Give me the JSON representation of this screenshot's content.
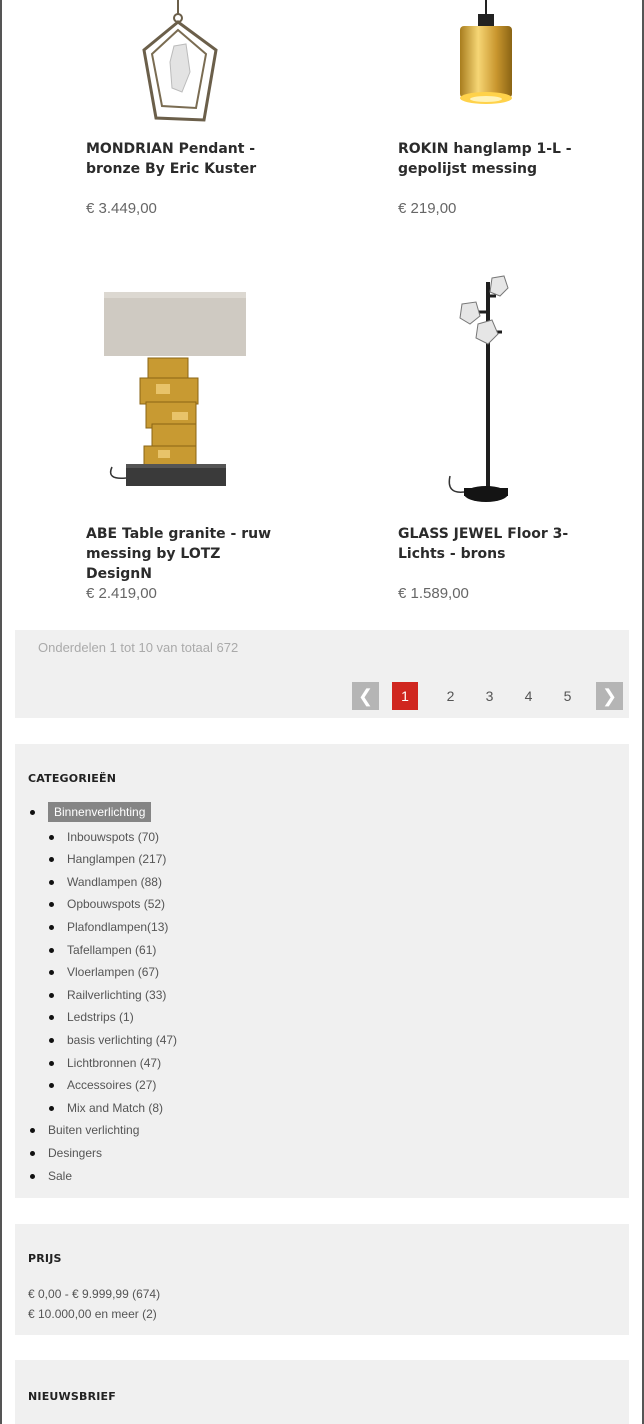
{
  "products": [
    {
      "name_line1": "MONDRIAN Pendant -",
      "name_line2": "bronze By Eric Kuster",
      "price": "€ 3.449,00",
      "icon": "pendant-lamp-image"
    },
    {
      "name_line1": "ROKIN hanglamp 1-L -",
      "name_line2": "gepolijst messing",
      "price": "€ 219,00",
      "icon": "brass-pendant-image"
    },
    {
      "name_line1": "ABE Table granite - ruw",
      "name_line2": "messing by LOTZ DesignN",
      "price": "€ 2.419,00",
      "icon": "table-lamp-image"
    },
    {
      "name_line1": "GLASS JEWEL Floor 3-",
      "name_line2": "Lichts - brons",
      "price": "€ 1.589,00",
      "icon": "floor-lamp-image"
    }
  ],
  "pager": {
    "count_text": "Onderdelen 1 tot 10 van totaal 672",
    "prev_icon": "chevron-left-icon",
    "next_icon": "chevron-right-icon",
    "pages": [
      "1",
      "2",
      "3",
      "4",
      "5"
    ],
    "active_page": "1",
    "active_color": "#d0261f"
  },
  "categories": {
    "title": "CATEGORIEËN",
    "active": "Binnenverlichting",
    "sub": [
      "Inbouwspots (70)",
      "Hanglampen (217)",
      "Wandlampen (88)",
      "Opbouwspots (52)",
      "Plafondlampen(13)",
      "Tafellampen (61)",
      "Vloerlampen (67)",
      "Railverlichting (33)",
      "Ledstrips (1)",
      "basis verlichting (47)",
      "Lichtbronnen (47)",
      "Accessoires (27)",
      "Mix and Match (8)"
    ],
    "others": [
      "Buiten verlichting",
      "Desingers",
      "Sale"
    ]
  },
  "price_filter": {
    "title": "PRIJS",
    "ranges": [
      "€ 0,00 - € 9.999,99 (674)",
      "€ 10.000,00 en meer (2)"
    ]
  },
  "newsletter": {
    "title": "NIEUWSBRIEF"
  }
}
